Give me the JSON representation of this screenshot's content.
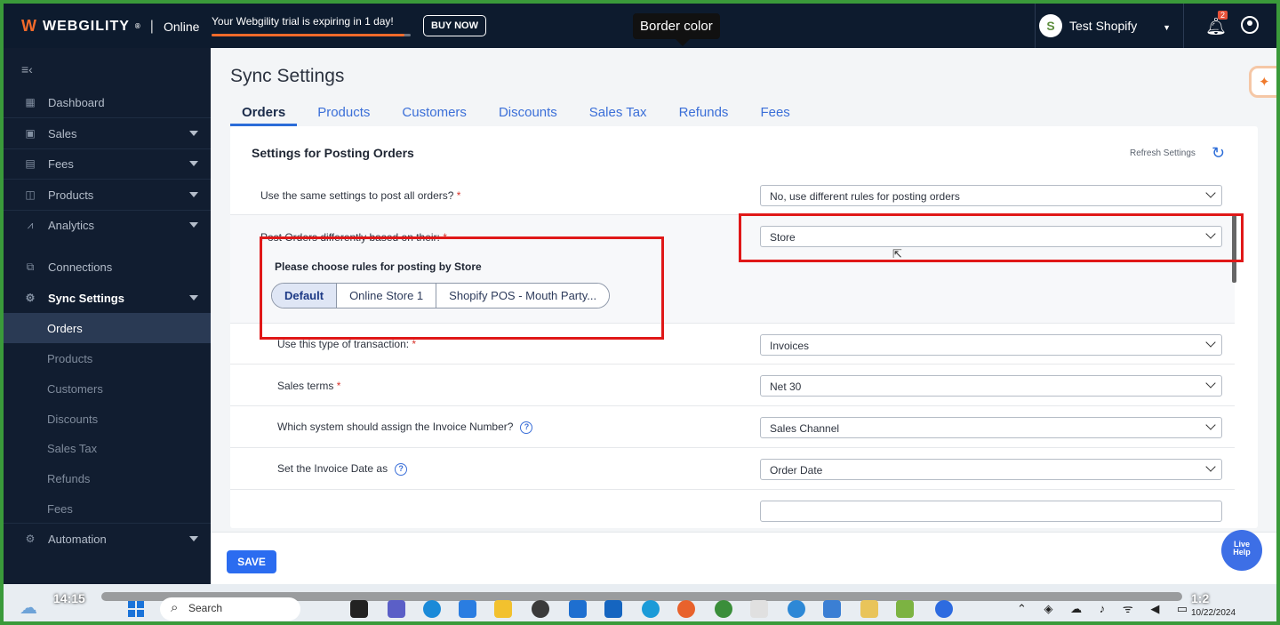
{
  "header": {
    "brand": "WEBGILITY",
    "trademark": "®",
    "edition": "Online",
    "trial_text": "Your Webgility trial is expiring in 1 day!",
    "trial_progress_pct": 97,
    "buy_now": "BUY NOW",
    "tooltip": "Border color",
    "store_name": "Test Shopify",
    "notification_count": "2"
  },
  "sidebar": {
    "items": [
      {
        "label": "Dashboard",
        "icon": "dashboard-icon"
      },
      {
        "label": "Sales",
        "icon": "sales-icon"
      },
      {
        "label": "Fees",
        "icon": "fees-icon"
      },
      {
        "label": "Products",
        "icon": "products-icon"
      },
      {
        "label": "Analytics",
        "icon": "analytics-icon"
      },
      {
        "label": "Connections",
        "icon": "connections-icon"
      },
      {
        "label": "Sync Settings",
        "icon": "gear-icon"
      },
      {
        "label": "Automation",
        "icon": "automation-icon"
      }
    ],
    "sync_sub_items": [
      "Orders",
      "Products",
      "Customers",
      "Discounts",
      "Sales Tax",
      "Refunds",
      "Fees"
    ]
  },
  "main": {
    "title": "Sync Settings",
    "tabs": [
      "Orders",
      "Products",
      "Customers",
      "Discounts",
      "Sales Tax",
      "Refunds",
      "Fees"
    ],
    "card_title": "Settings for Posting Orders",
    "refresh_label": "Refresh Settings",
    "q_same_settings": "Use the same settings to post all orders?",
    "v_same_settings": "No, use different rules for posting orders",
    "q_post_diff": "Post Orders differently based on their:",
    "v_post_diff": "Store",
    "rules_title": "Please choose rules for posting by Store",
    "store_buttons": [
      "Default",
      "Online Store 1",
      "Shopify POS - Mouth Party..."
    ],
    "q_transaction": "Use this type of transaction:",
    "v_transaction": "Invoices",
    "q_terms": "Sales terms",
    "v_terms": "Net 30",
    "q_invoice_number": "Which system should assign the Invoice Number?",
    "v_invoice_number": "Sales Channel",
    "q_invoice_date": "Set the Invoice Date as",
    "v_invoice_date": "Order Date",
    "required_mark": "*",
    "help_glyph": "?"
  },
  "footer": {
    "save": "SAVE",
    "live_help_line1": "Live",
    "live_help_line2": "Help"
  },
  "taskbar": {
    "player_time": "14:15",
    "player_time_right": "1:2",
    "search": "Search",
    "date": "10/22/2024"
  },
  "colors": {
    "accent": "#2b6cf0",
    "nav_bg": "#111d30",
    "highlight_red": "#e01818",
    "brand_orange": "#f26a2a"
  }
}
